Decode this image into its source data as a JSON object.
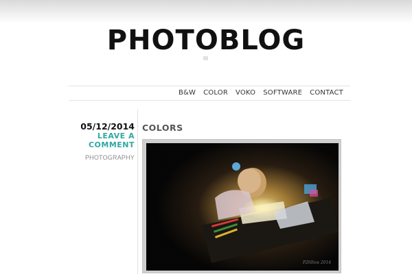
{
  "site": {
    "title": "PHOTOBLOG"
  },
  "nav": {
    "items": [
      {
        "label": "B&W"
      },
      {
        "label": "COLOR"
      },
      {
        "label": "VOKO"
      },
      {
        "label": "SOFTWARE"
      },
      {
        "label": "CONTACT"
      }
    ]
  },
  "post": {
    "date": "05/12/2014",
    "comment_link": "LEAVE A COMMENT",
    "category": "PHOTOGRAPHY",
    "title": "COLORS"
  },
  "colors": {
    "accent_link": "#2fa8a1",
    "title_text": "#111111",
    "photo_frame": "#cfcfcf"
  }
}
